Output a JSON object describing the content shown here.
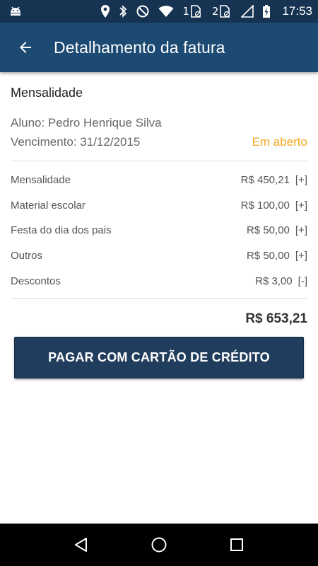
{
  "status_bar": {
    "sim1": "1",
    "sim2": "2",
    "time": "17:53"
  },
  "app_bar": {
    "title": "Detalhamento da fatura"
  },
  "invoice": {
    "section_title": "Mensalidade",
    "student": "Aluno: Pedro Henrique Silva",
    "due_date": "Vencimento: 31/12/2015",
    "status": "Em aberto",
    "items": [
      {
        "label": "Mensalidade",
        "amount": "R$ 450,21",
        "toggle": "[+]"
      },
      {
        "label": "Material escolar",
        "amount": "R$ 100,00",
        "toggle": "[+]"
      },
      {
        "label": "Festa do dia dos pais",
        "amount": "R$ 50,00",
        "toggle": "[+]"
      },
      {
        "label": "Outros",
        "amount": "R$ 50,00",
        "toggle": "[+]"
      },
      {
        "label": "Descontos",
        "amount": "R$ 3,00",
        "toggle": "[-]"
      }
    ],
    "total": "R$ 653,21"
  },
  "actions": {
    "pay_label": "PAGAR COM CARTÃO DE CRÉDITO"
  },
  "colors": {
    "status_bar": "#163452",
    "app_bar": "#1c4a72",
    "button": "#213d5d",
    "status_open": "#f4a81e"
  }
}
